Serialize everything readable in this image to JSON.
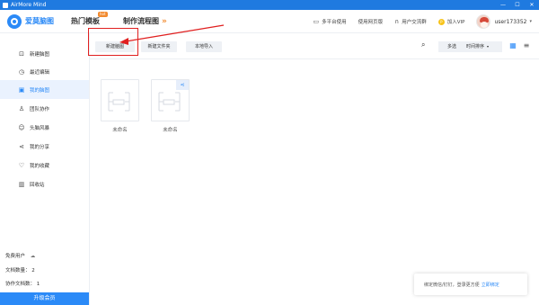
{
  "titlebar": {
    "title": "AirMore Mind"
  },
  "header": {
    "logo_text": "爱莫脑图",
    "nav": [
      {
        "label": "热门模板",
        "badge": "hot"
      },
      {
        "label": "制作流程图",
        "chevron": "»"
      }
    ],
    "links": [
      {
        "icon": "monitor-icon",
        "label": "多平台使用"
      },
      {
        "icon": "web-icon",
        "label": "使用网页版"
      },
      {
        "icon": "headset-icon",
        "label": "用户交流群"
      },
      {
        "icon": "vip-icon",
        "label": "加入VIP",
        "icon_text": "P"
      }
    ],
    "username": "user173352"
  },
  "sidebar": {
    "items": [
      {
        "icon": "new-file-icon",
        "label": "新建脑图"
      },
      {
        "icon": "clock-icon",
        "label": "最近编辑"
      },
      {
        "icon": "my-mindmap-icon",
        "label": "我的脑图"
      },
      {
        "icon": "team-icon",
        "label": "团队协作"
      },
      {
        "icon": "brainstorm-icon",
        "label": "头脑风暴"
      },
      {
        "icon": "share-icon",
        "label": "我的分享"
      },
      {
        "icon": "heart-icon",
        "label": "我的收藏"
      },
      {
        "icon": "trash-icon",
        "label": "回收站"
      }
    ],
    "active_index": 2,
    "account_type": "免费用户",
    "doc_count_label": "文档数量：",
    "doc_count": "2",
    "collab_count_label": "协作文档数：",
    "collab_count": "1",
    "upgrade_label": "升级会员"
  },
  "toolbar": {
    "new_mindmap": "新建脑图",
    "new_folder": "新建文件夹",
    "local_import": "本地导入",
    "multi_select": "多选",
    "sort_label": "时间排序",
    "sort_chevron": "▾"
  },
  "files": [
    {
      "name": "未命名",
      "shared": false
    },
    {
      "name": "未命名",
      "shared": true
    }
  ],
  "toast": {
    "text": "绑定微信/钉钉，登录更方便",
    "link": "立即绑定"
  },
  "colors": {
    "titlebar": "#1f7ae0",
    "accent": "#2b8af7",
    "annotation": "#e02020",
    "hot_badge": "#f28a2e"
  }
}
